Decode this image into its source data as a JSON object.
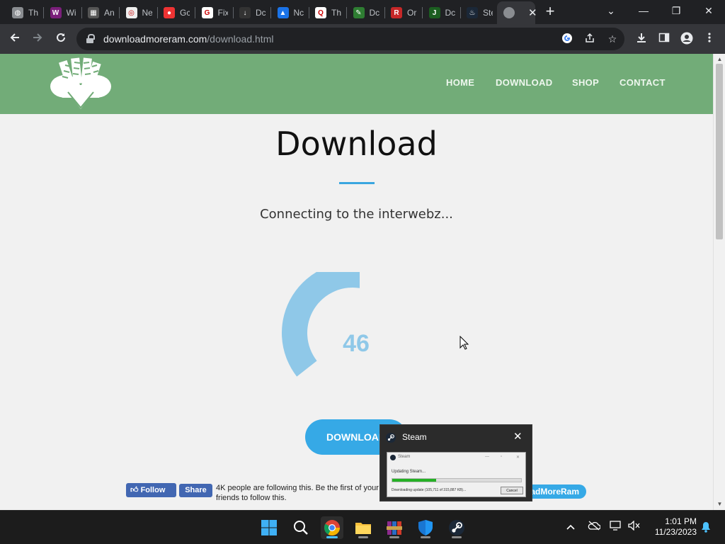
{
  "browser": {
    "tabs": [
      {
        "label": "Th",
        "icon": "globe-icon"
      },
      {
        "label": "Wi",
        "icon": "winrar-icon"
      },
      {
        "label": "An",
        "icon": "film-icon"
      },
      {
        "label": "Ne",
        "icon": "chrome-icon"
      },
      {
        "label": "Gc",
        "icon": "ghost-icon"
      },
      {
        "label": "Fix",
        "icon": "google-icon"
      },
      {
        "label": "Dc",
        "icon": "download-icon"
      },
      {
        "label": "Nc",
        "icon": "drive-icon"
      },
      {
        "label": "Th",
        "icon": "search-icon"
      },
      {
        "label": "Dc",
        "icon": "pen-icon"
      },
      {
        "label": "Or",
        "icon": "r-logo-icon"
      },
      {
        "label": "Dc",
        "icon": "j-logo-icon"
      },
      {
        "label": "Ste",
        "icon": "steam-icon"
      }
    ],
    "active_tab": {
      "label": "",
      "icon": "globe-icon",
      "close": "✕"
    },
    "new_tab": "+",
    "window_controls": {
      "dropdown": "⌄",
      "minimize": "—",
      "maximize": "❐",
      "close": "✕"
    },
    "url_host": "downloadmoreram.com",
    "url_path": "/download.html"
  },
  "site": {
    "nav": [
      "HOME",
      "DOWNLOAD",
      "SHOP",
      "CONTACT"
    ],
    "page_title": "Download",
    "status": "Connecting to the interwebz...",
    "progress_value": "46",
    "download_button": "DOWNLOAD",
    "fb_follow": "Follow",
    "fb_share": "Share",
    "fb_text": "4K people are following this. Be the first of your friends to follow this.",
    "social_pill": "adMoreRam"
  },
  "steam_preview": {
    "title": "Steam",
    "window_title": "Steam",
    "updating": "Updating Steam...",
    "progress_fraction": 0.34,
    "downloading": "Downloading update (105,711 of 315,887 KB)...",
    "cancel": "Cancel"
  },
  "taskbar": {
    "time": "1:01 PM",
    "date": "11/23/2023",
    "tray_chevron": "^"
  },
  "colors": {
    "header_green": "#72ac78",
    "accent_blue": "#36a9e6",
    "gauge_blue": "#8fc8e8"
  }
}
